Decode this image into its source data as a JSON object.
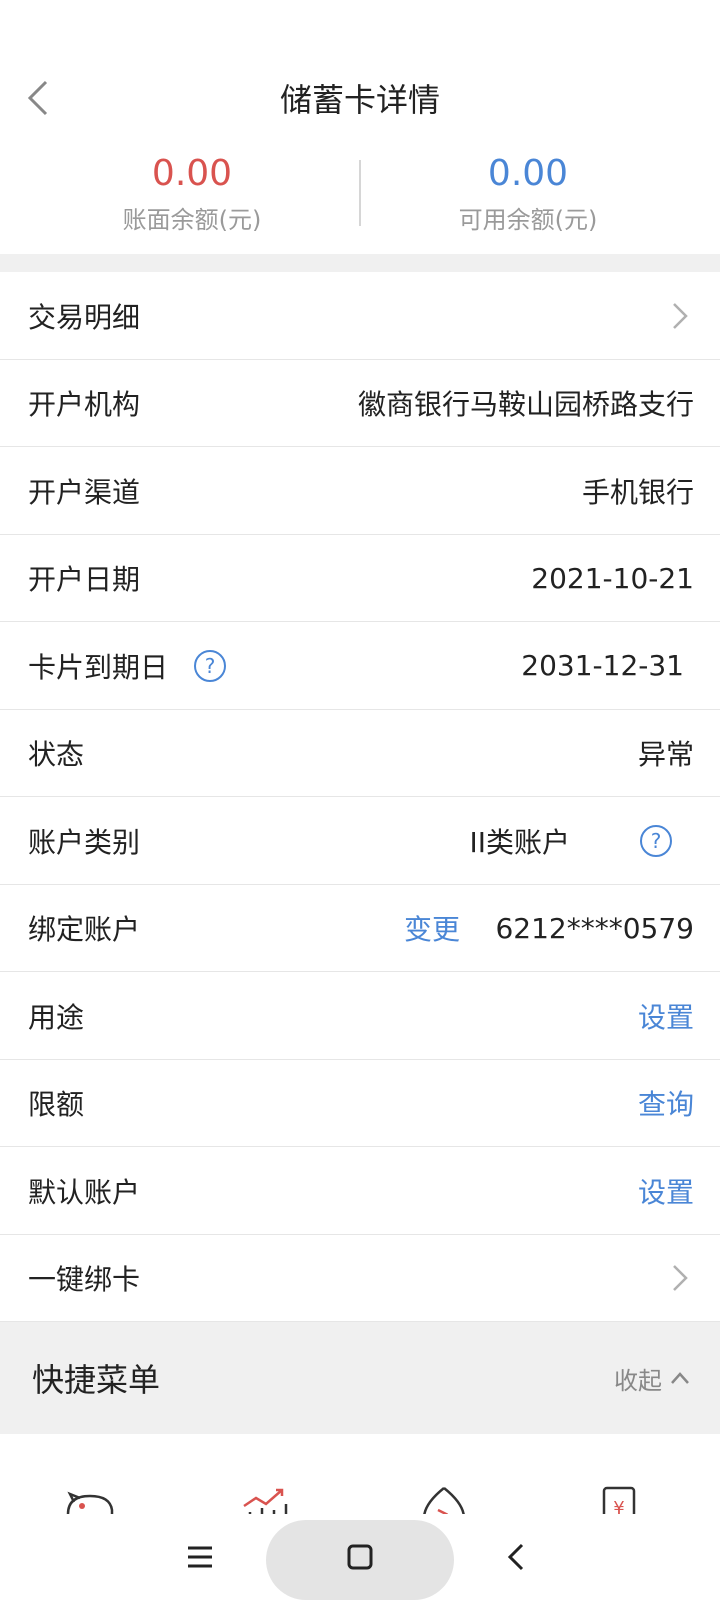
{
  "header": {
    "title": "储蓄卡详情"
  },
  "balances": {
    "book": {
      "value": "0.00",
      "label": "账面余额(元)",
      "color": "#d9534f"
    },
    "available": {
      "value": "0.00",
      "label": "可用余额(元)",
      "color": "#4a86d6"
    }
  },
  "rows": [
    {
      "label": "交易明细"
    },
    {
      "label": "开户机构",
      "value": "徽商银行马鞍山园桥路支行"
    },
    {
      "label": "开户渠道",
      "value": "手机银行"
    },
    {
      "label": "开户日期",
      "value": "2021-10-21"
    },
    {
      "label": "卡片到期日",
      "value": "2031-12-31"
    },
    {
      "label": "状态",
      "value": "异常"
    },
    {
      "label": "账户类别",
      "value": "II类账户"
    },
    {
      "label": "绑定账户",
      "action": "变更",
      "value": "6212****0579"
    },
    {
      "label": "用途",
      "action": "设置"
    },
    {
      "label": "限额",
      "action": "查询"
    },
    {
      "label": "默认账户",
      "action": "设置"
    },
    {
      "label": "一键绑卡"
    }
  ],
  "quick_menu": {
    "title": "快捷菜单",
    "collapse_label": "收起"
  },
  "colors": {
    "accent_blue": "#4a86d6",
    "accent_red": "#d9534f"
  }
}
